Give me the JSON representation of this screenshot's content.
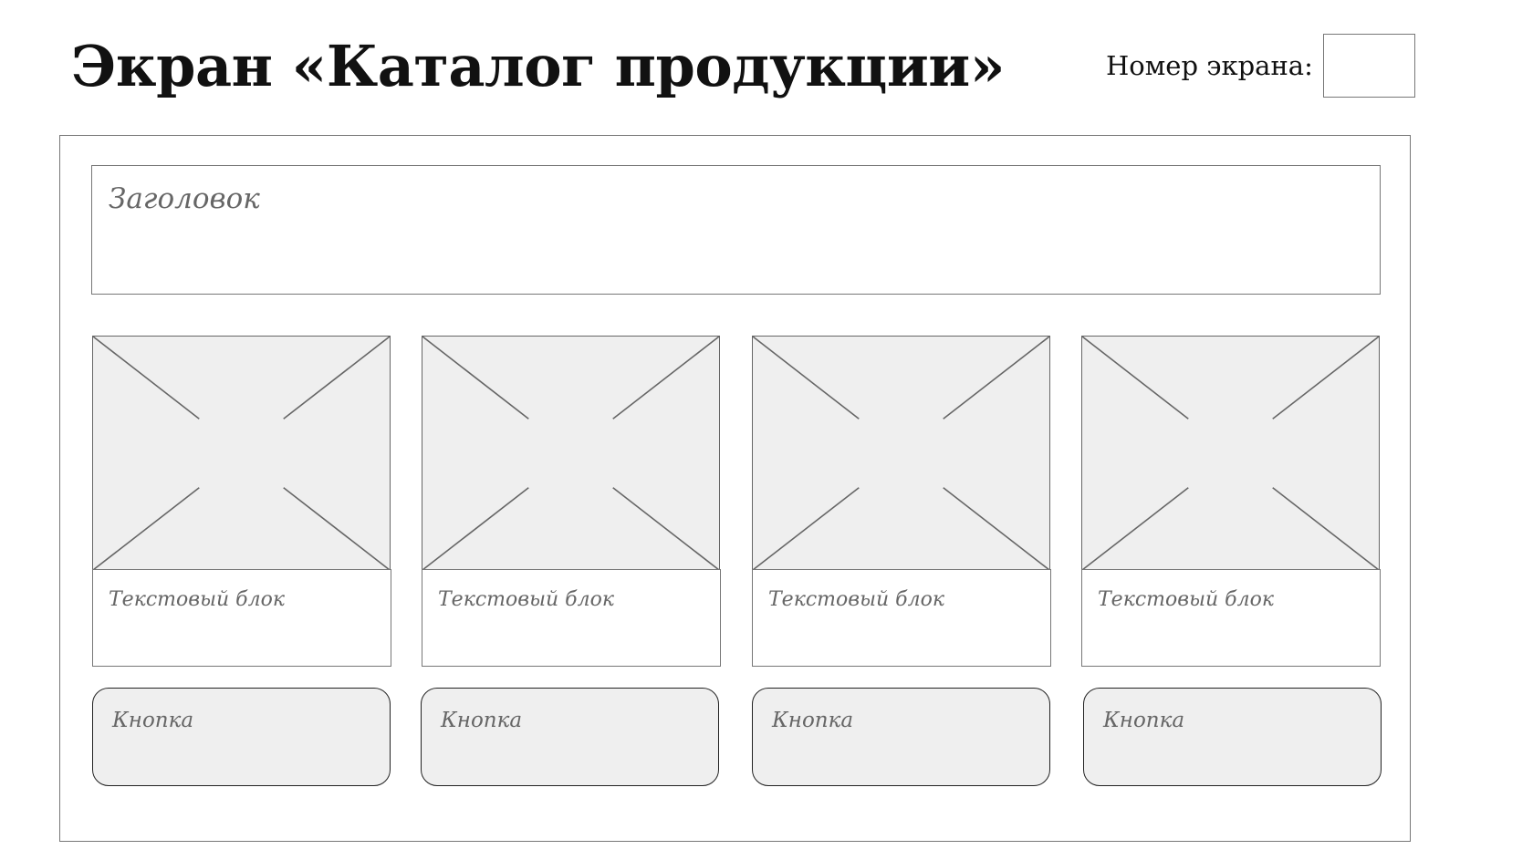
{
  "screen": {
    "title": "Экран «Каталог продукции»",
    "number_label": "Номер экрана:",
    "number_value": ""
  },
  "header": {
    "label": "Заголовок"
  },
  "products": [
    {
      "image_icon": "image-placeholder-icon",
      "text_label": "Текстовый блок",
      "button_label": "Кнопка"
    },
    {
      "image_icon": "image-placeholder-icon",
      "text_label": "Текстовый блок",
      "button_label": "Кнопка"
    },
    {
      "image_icon": "image-placeholder-icon",
      "text_label": "Текстовый блок",
      "button_label": "Кнопка"
    },
    {
      "image_icon": "image-placeholder-icon",
      "text_label": "Текстовый блок",
      "button_label": "Кнопка"
    }
  ],
  "colors": {
    "placeholder_fill": "#efefef",
    "border": "#777777",
    "button_border": "#222222",
    "muted_text": "#666666"
  }
}
